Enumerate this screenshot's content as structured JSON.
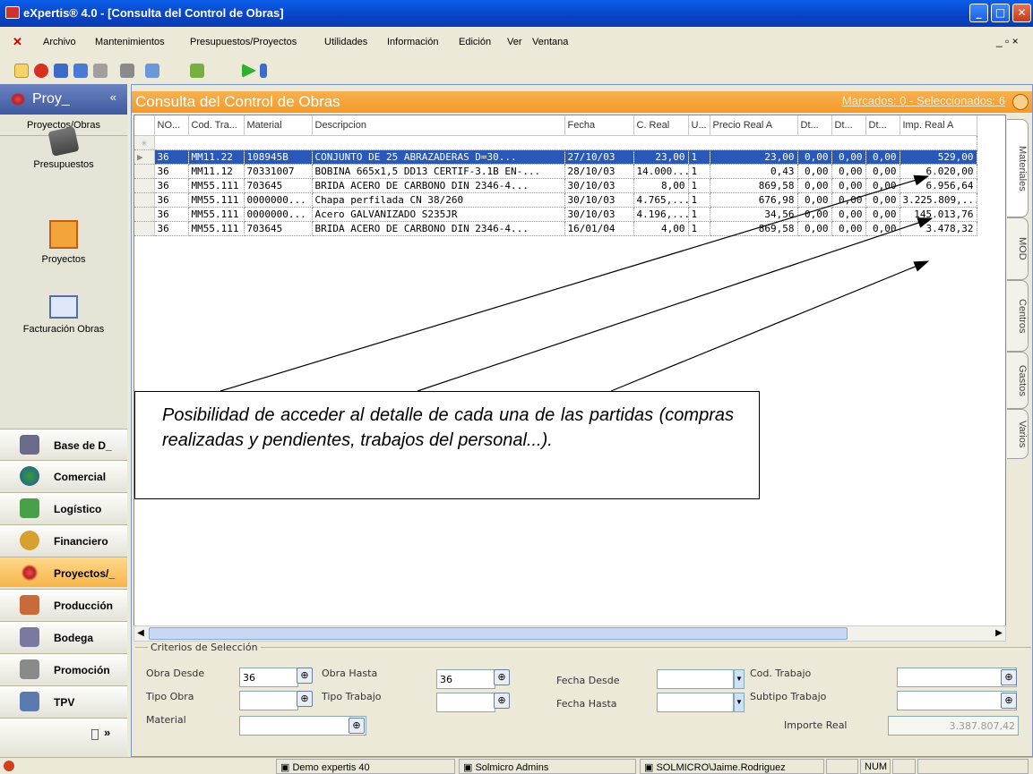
{
  "window": {
    "title": "eXpertis® 4.0 - [Consulta del Control de Obras]",
    "min": "_",
    "max": "□",
    "close": "✕"
  },
  "menu": {
    "items": [
      "Archivo",
      "Mantenimientos",
      "Presupuestos/Proyectos",
      "Utilidades",
      "Información",
      "Edición",
      "Ver",
      "Ventana"
    ],
    "controls": "_ ▫ ×"
  },
  "sidebar": {
    "header": "Proy_",
    "chevron": "«",
    "subheader": "Proyectos/Obras",
    "nav": [
      "Presupuestos",
      "Proyectos",
      "Facturación Obras"
    ],
    "modules": [
      "Base de D_",
      "Comercial",
      "Logístico",
      "Financiero",
      "Proyectos/_",
      "Producción",
      "Bodega",
      "Promoción",
      "TPV"
    ],
    "more": "»"
  },
  "main": {
    "title": "Consulta del Control de Obras",
    "marked": "Marcados: 0 - Seleccionados: 6"
  },
  "grid": {
    "columns": [
      "NO...",
      "Cod. Tra...",
      "Material",
      "Descripcion",
      "Fecha",
      "C. Real",
      "U...",
      "Precio Real A",
      "Dt...",
      "Dt...",
      "Dt...",
      "Imp. Real A"
    ],
    "rows": [
      [
        "36",
        "MM11.22",
        "108945B",
        "CONJUNTO DE 25 ABRAZADERAS D=30...",
        "27/10/03",
        "23,00",
        "1",
        "23,00",
        "0,00",
        "0,00",
        "0,00",
        "529,00"
      ],
      [
        "36",
        "MM11.12",
        "70331007",
        "BOBINA 665x1,5 DD13 CERTIF-3.1B EN-...",
        "28/10/03",
        "14.000...",
        "1",
        "0,43",
        "0,00",
        "0,00",
        "0,00",
        "6.020,00"
      ],
      [
        "36",
        "MM55.111",
        "703645",
        "BRIDA ACERO DE CARBONO DIN 2346-4...",
        "30/10/03",
        "8,00",
        "1",
        "869,58",
        "0,00",
        "0,00",
        "0,00",
        "6.956,64"
      ],
      [
        "36",
        "MM55.111",
        "0000000...",
        "Chapa perfilada CN 38/260",
        "30/10/03",
        "4.765,...",
        "1",
        "676,98",
        "0,00",
        "0,00",
        "0,00",
        "3.225.809,..."
      ],
      [
        "36",
        "MM55.111",
        "0000000...",
        "Acero  GALVANIZADO S235JR",
        "30/10/03",
        "4.196,...",
        "1",
        "34,56",
        "0,00",
        "0,00",
        "0,00",
        "145.013,76"
      ],
      [
        "36",
        "MM55.111",
        "703645",
        "BRIDA ACERO DE CARBONO DIN 2346-4...",
        "16/01/04",
        "4,00",
        "1",
        "869,58",
        "0,00",
        "0,00",
        "0,00",
        "3.478,32"
      ]
    ]
  },
  "tabs": [
    "Materiales",
    "MOD",
    "Centros",
    "Gastos",
    "Varios"
  ],
  "criteria": {
    "legend": "Criterios de Selección",
    "obra_desde": "Obra Desde",
    "obra_desde_val": "36",
    "obra_hasta": "Obra Hasta",
    "obra_hasta_val": "36",
    "fecha_desde": "Fecha Desde",
    "fecha_hasta": "Fecha Hasta",
    "cod_trabajo": "Cod. Trabajo",
    "tipo_obra": "Tipo Obra",
    "tipo_trabajo": "Tipo Trabajo",
    "subtipo": "Subtipo Trabajo",
    "material": "Material",
    "importe": "Importe Real",
    "importe_val": "3.387.807,42"
  },
  "status": {
    "db": "Demo expertis 40",
    "admins": "Solmicro Admins",
    "user": "SOLMICRO\\Jaime.Rodriguez",
    "num": "NUM"
  },
  "callout": "Posibilidad de acceder al detalle de cada una de las partidas (compras realizadas y pendientes, trabajos del personal...)."
}
